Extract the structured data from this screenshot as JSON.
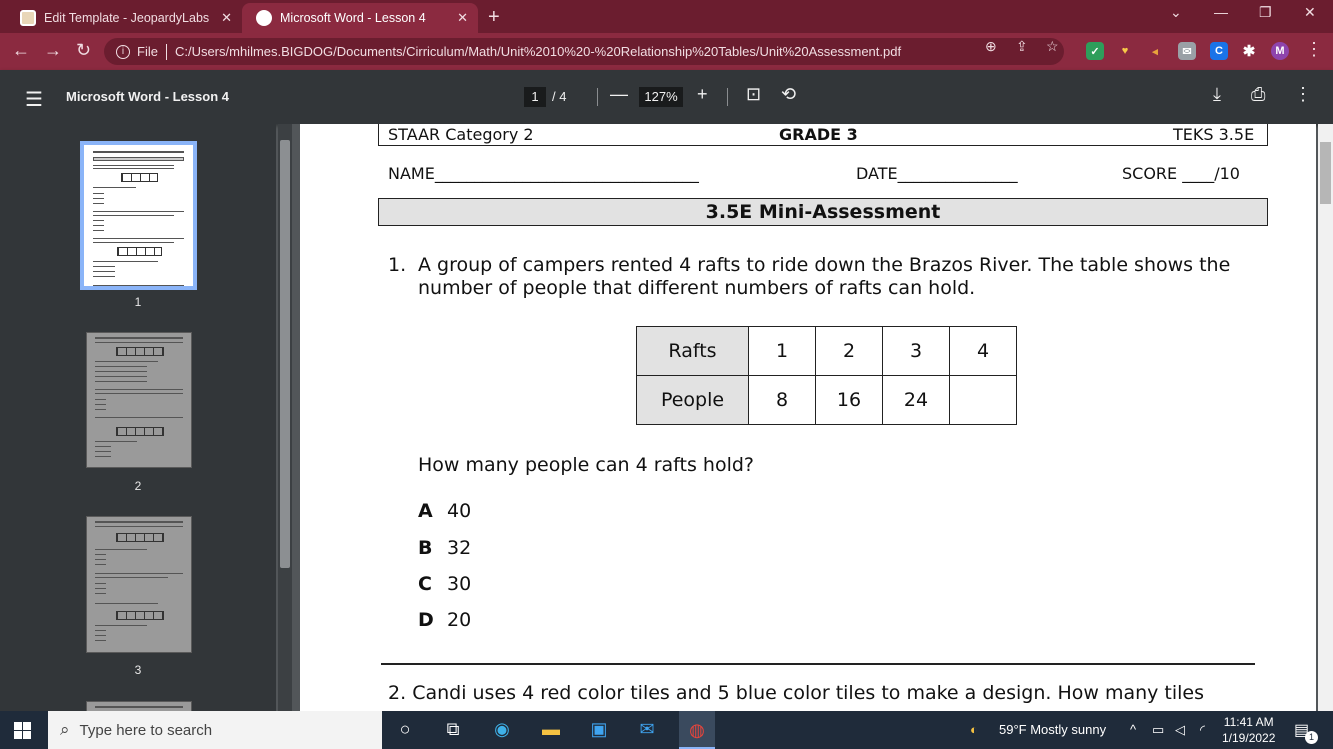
{
  "browser": {
    "tabs": [
      {
        "title": "Edit Template - JeopardyLabs"
      },
      {
        "title": "Microsoft Word - Lesson 4"
      }
    ],
    "url_prefix": "File",
    "url": "C:/Users/mhilmes.BIGDOG/Documents/Cirriculum/Math/Unit%2010%20-%20Relationship%20Tables/Unit%20Assessment.pdf",
    "profile_initial": "M",
    "ext_c_label": "C"
  },
  "pdf_toolbar": {
    "title": "Microsoft Word - Lesson 4",
    "current_page": "1",
    "total_pages": "/ 4",
    "zoom": "127%"
  },
  "sidebar": {
    "thumbnails": [
      {
        "number": "1"
      },
      {
        "number": "2"
      },
      {
        "number": "3"
      }
    ]
  },
  "document": {
    "header": {
      "category": "STAAR Category 2",
      "grade": "GRADE 3",
      "teks": "TEKS 3.5E"
    },
    "name_label": "NAME_________________________________",
    "date_label": "DATE_______________",
    "score_label": "SCORE ____/10",
    "title": "3.5E Mini-Assessment",
    "q1": {
      "number": "1.",
      "text": "A group of campers rented 4 rafts to ride down the Brazos River.  The table shows the number of people that different numbers of rafts can hold.",
      "table": {
        "row1": [
          "Rafts",
          "1",
          "2",
          "3",
          "4"
        ],
        "row2": [
          "People",
          "8",
          "16",
          "24",
          ""
        ]
      },
      "question": "How many people can 4 rafts hold?",
      "options": [
        {
          "letter": "A",
          "value": "40"
        },
        {
          "letter": "B",
          "value": "32"
        },
        {
          "letter": "C",
          "value": "30"
        },
        {
          "letter": "D",
          "value": "20"
        }
      ]
    },
    "q2": {
      "number": "2.",
      "text": "Candi uses 4 red color tiles and 5 blue color tiles to make a design.  How many tiles"
    }
  },
  "taskbar": {
    "search_placeholder": "Type here to search",
    "weather": "59°F  Mostly sunny",
    "time": "11:41 AM",
    "date": "1/19/2022",
    "notification_count": "1"
  }
}
